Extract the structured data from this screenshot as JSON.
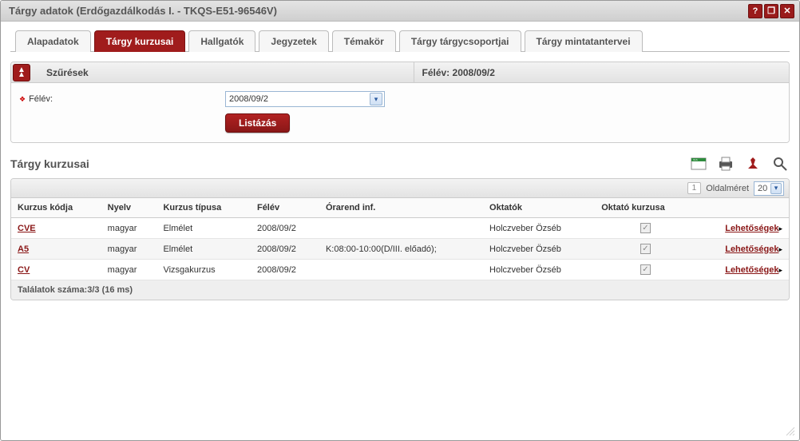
{
  "window": {
    "title": "Tárgy adatok (Erdőgazdálkodás I. - TKQS-E51-96546V)"
  },
  "tabs": [
    {
      "label": "Alapadatok"
    },
    {
      "label": "Tárgy kurzusai",
      "active": true
    },
    {
      "label": "Hallgatók"
    },
    {
      "label": "Jegyzetek"
    },
    {
      "label": "Témakör"
    },
    {
      "label": "Tárgy tárgycsoportjai"
    },
    {
      "label": "Tárgy mintatantervei"
    }
  ],
  "filter": {
    "header_left": "Szűrések",
    "header_right": "Félév: 2008/09/2",
    "field_label": "Félév:",
    "field_value": "2008/09/2",
    "button": "Listázás"
  },
  "section_title": "Tárgy kurzusai",
  "pager": {
    "page": "1",
    "page_size_label": "Oldalméret",
    "page_size_value": "20"
  },
  "columns": {
    "code": "Kurzus kódja",
    "lang": "Nyelv",
    "type": "Kurzus típusa",
    "term": "Félév",
    "schedule": "Órarend inf.",
    "teachers": "Oktatók",
    "teacher_course": "Oktató kurzusa"
  },
  "rows": [
    {
      "code": "CVE",
      "lang": "magyar",
      "type": "Elmélet",
      "term": "2008/09/2",
      "schedule": "",
      "teachers": "Holczveber Özséb",
      "teacher_course": true,
      "options": "Lehetőségek"
    },
    {
      "code": "A5",
      "lang": "magyar",
      "type": "Elmélet",
      "term": "2008/09/2",
      "schedule": "K:08:00-10:00(D/III. előadó);",
      "teachers": "Holczveber Özséb",
      "teacher_course": true,
      "options": "Lehetőségek"
    },
    {
      "code": "CV",
      "lang": "magyar",
      "type": "Vizsgakurzus",
      "term": "2008/09/2",
      "schedule": "",
      "teachers": "Holczveber Özséb",
      "teacher_course": true,
      "options": "Lehetőségek"
    }
  ],
  "footer": "Találatok száma:3/3 (16 ms)",
  "icons": {
    "help": "?",
    "popout": "❐",
    "close": "✕",
    "collapse": "▲",
    "combo_arrow": "▾",
    "option_arrow": "▸",
    "check": "✓"
  }
}
